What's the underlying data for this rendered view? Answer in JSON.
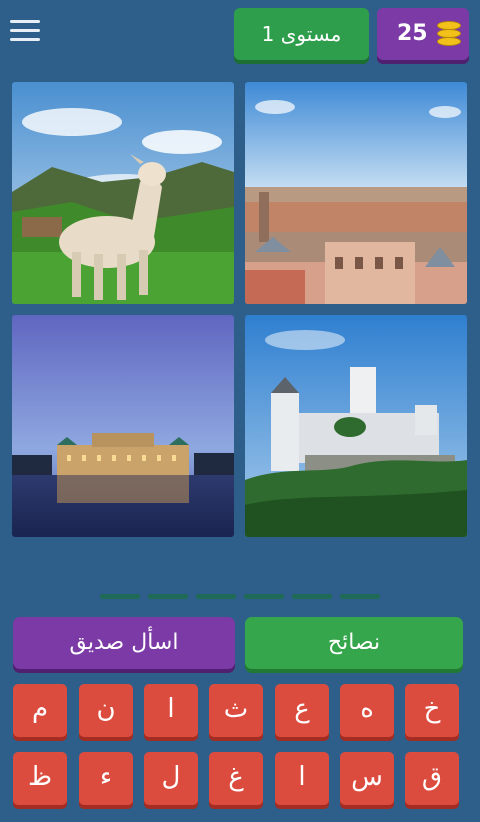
{
  "header": {
    "menu_icon": "hamburger-menu-icon",
    "coins": "25",
    "coin_icon": "coin-stack-icon",
    "level_label": "مستوى 1"
  },
  "images": [
    "goat",
    "city-panorama",
    "palace-reflection",
    "hilltop-fortress"
  ],
  "answer_slots": 6,
  "buttons": {
    "ask_friend": "اسأل صديق",
    "hints": "نصائح"
  },
  "keyboard": {
    "row1": [
      "م",
      "ن",
      "ا",
      "ث",
      "ع",
      "ه",
      "خ"
    ],
    "row2": [
      "ظ",
      "ء",
      "ل",
      "غ",
      "ا",
      "س",
      "ق"
    ]
  },
  "colors": {
    "background": "#2e5f8a",
    "purple": "#7b3aa6",
    "green": "#35a64b",
    "key_red": "#db4c3f"
  }
}
